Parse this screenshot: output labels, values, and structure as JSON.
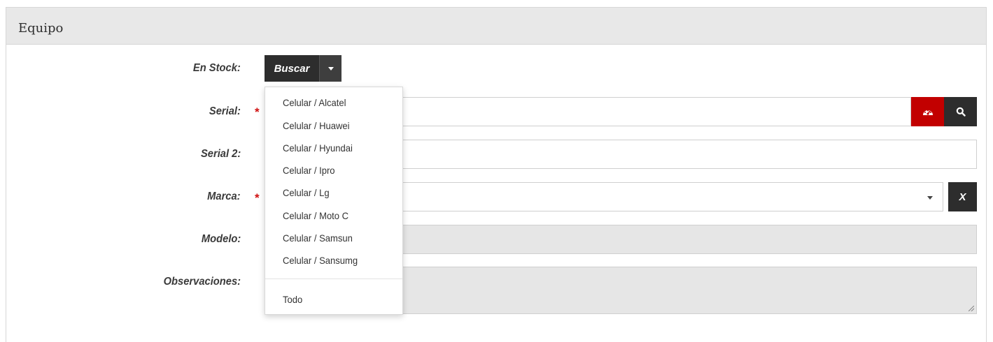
{
  "panel": {
    "title": "Equipo"
  },
  "form": {
    "en_stock_label": "En Stock:",
    "serial_label": "Serial:",
    "serial2_label": "Serial 2:",
    "marca_label": "Marca:",
    "modelo_label": "Modelo:",
    "observaciones_label": "Observaciones:",
    "required_mark": "*",
    "buscar_label": "Buscar",
    "clear_label": "X"
  },
  "dropdown": {
    "items": [
      "Celular / Alcatel",
      "Celular / Huawei",
      "Celular / Hyundai",
      "Celular / Ipro",
      "Celular / Lg",
      "Celular / Moto C",
      "Celular / Samsun",
      "Celular / Sansumg"
    ],
    "all_label": "Todo"
  },
  "icons": {
    "dashboard": "dashboard-icon",
    "search": "search-icon",
    "caret": "caret-down-icon",
    "resize": "resize-grip-icon"
  },
  "colors": {
    "header_bg": "#e8e8e8",
    "button_dark": "#2d2d2d",
    "button_red": "#c20000",
    "required": "#d01010",
    "disabled_input": "#e6e6e6"
  }
}
